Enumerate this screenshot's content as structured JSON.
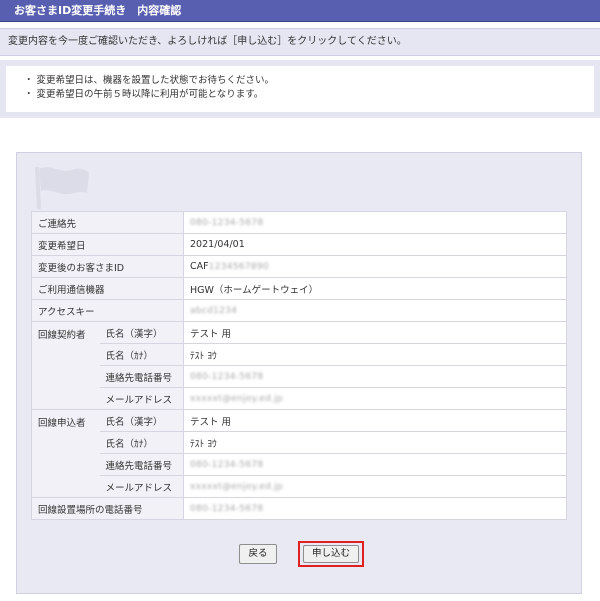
{
  "header": {
    "title": "お客さまID変更手続き　内容確認"
  },
  "intro": {
    "text": "変更内容を今一度ご確認いただき、よろしければ［申し込む］をクリックしてください。"
  },
  "notes": [
    "・ 変更希望日は、機器を設置した状態でお待ちください。",
    "・ 変更希望日の午前５時以降に利用が可能となります。"
  ],
  "rows": {
    "contact": {
      "label": "ご連絡先",
      "value": "080-1234-5678"
    },
    "date": {
      "label": "変更希望日",
      "value": "2021/04/01"
    },
    "new_id": {
      "label": "変更後のお客さまID",
      "prefix": "CAF",
      "value": "1234567890"
    },
    "device": {
      "label": "ご利用通信機器",
      "value": "HGW（ホームゲートウェイ）"
    },
    "access_key": {
      "label": "アクセスキー",
      "value": "abcd1234"
    },
    "contractor": {
      "group": "回線契約者",
      "name_kanji_label": "氏名（漢字）",
      "name_kanji": "テスト 用",
      "name_kana_label": "氏名（ｶﾅ）",
      "name_kana": "ﾃｽﾄ ﾖｳ",
      "phone_label": "連絡先電話番号",
      "phone": "080-1234-5678",
      "mail_label": "メールアドレス",
      "mail": "xxxxxt@enjoy.ed.jp"
    },
    "applicant": {
      "group": "回線申込者",
      "name_kanji_label": "氏名（漢字）",
      "name_kanji": "テスト 用",
      "name_kana_label": "氏名（ｶﾅ）",
      "name_kana": "ﾃｽﾄ ﾖｳ",
      "phone_label": "連絡先電話番号",
      "phone": "080-1234-5678",
      "mail_label": "メールアドレス",
      "mail": "xxxxxt@enjoy.ed.jp"
    },
    "site_phone": {
      "label": "回線設置場所の電話番号",
      "value": "080-1234-5678"
    }
  },
  "buttons": {
    "back": "戻る",
    "apply": "申し込む"
  },
  "colors": {
    "header_bg": "#595fb0",
    "panel_bg": "#e9e9f3",
    "highlight": "#e02020"
  }
}
